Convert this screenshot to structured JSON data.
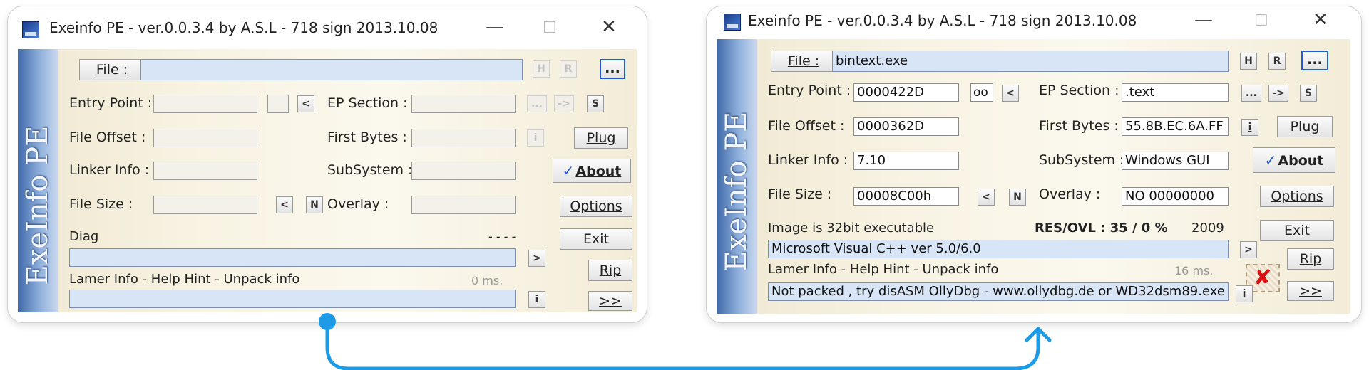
{
  "title": "Exeinfo PE - ver.0.0.3.4  by A.S.L -  718 sign 2013.10.08",
  "app_icon": "asl-app-icon",
  "side_label": "ExeInfo PE",
  "labels": {
    "file": "File :",
    "entry_point": "Entry Point :",
    "ep_section": "EP Section :",
    "file_offset": "File Offset :",
    "first_bytes": "First Bytes :",
    "linker_info": "Linker Info :",
    "subsystem": "SubSystem :",
    "file_size": "File Size :",
    "overlay": "Overlay :",
    "diag": "Diag",
    "lamer": "Lamer Info - Help Hint - Unpack info"
  },
  "buttons": {
    "h": "H",
    "r": "R",
    "browse": "...",
    "lt": "<",
    "s": "S",
    "ell": "...",
    "arrow": "->",
    "i": "i",
    "n": "N",
    "gt": ">",
    "plug": "Plug",
    "about": "About",
    "options": "Options",
    "exit": "Exit",
    "rip": "Rip",
    "next": ">>",
    "oo": "oo"
  },
  "window_controls": {
    "minimize": "—",
    "maximize": "☐",
    "close": "✕"
  },
  "left": {
    "file": "",
    "entry_point": "",
    "ep_section": "",
    "file_offset": "",
    "first_bytes": "",
    "linker_info": "",
    "subsystem": "",
    "file_size": "",
    "overlay": "",
    "diag_status": "- - - -",
    "diag_output": "",
    "time": "0 ms.",
    "lamer_output": ""
  },
  "right": {
    "file": "bintext.exe",
    "entry_point": "0000422D",
    "ep_section": ".text",
    "file_offset": "0000362D",
    "first_bytes": "55.8B.EC.6A.FF",
    "linker_info": "7.10",
    "subsystem": "Windows GUI",
    "file_size": "00008C00h",
    "overlay": "NO   00000000",
    "image_info": "Image is 32bit executable",
    "res_ovl": "RES/OVL : 35 / 0 %",
    "year": "2009",
    "compiler": "Microsoft Visual C++ ver 5.0/6.0",
    "time": "16 ms.",
    "lamer_output": "Not packed , try disASM OllyDbg - www.ollydbg.de or  WD32dsm89.exe",
    "stamp": "✘"
  },
  "colors": {
    "arrow": "#1e9be6",
    "field_blue": "#d8e5f7",
    "browse_border": "#1e5bd6"
  }
}
